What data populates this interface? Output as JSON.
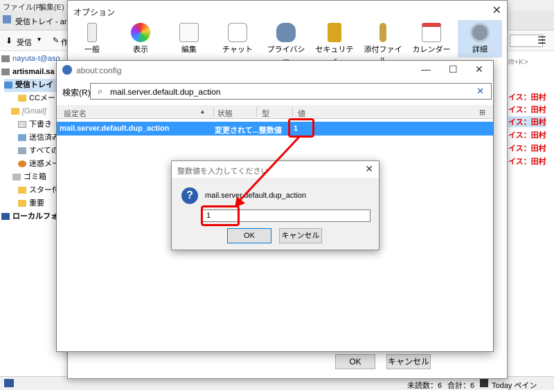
{
  "background": {
    "menu": [
      "ファイル(F)",
      "編集(E)"
    ],
    "tab_title": "受信トレイ - arti",
    "toolbar": {
      "receive": "受信",
      "write": "作"
    },
    "accounts": [
      "nayuta-t@aso",
      "artismail.sa"
    ],
    "folders": [
      "受信トレイ",
      "CCメール",
      "[Gmail]",
      "下書き",
      "送信済み",
      "すべてのメ",
      "迷惑メール",
      "ゴミ箱",
      "スター付き",
      "重要",
      "ローカルフォル"
    ],
    "right_search_hint": "ift+K>",
    "right_senders": [
      "イス：田村",
      "イス：田村",
      "イス：田村",
      "イス：田村",
      "イス：田村",
      "イス：田村"
    ],
    "status": {
      "unread": "未読数：6",
      "total": "合計：6",
      "today": "Today ペイン"
    }
  },
  "options": {
    "title": "オプション",
    "tabs": [
      "一般",
      "表示",
      "編集",
      "チャット",
      "プライバシー",
      "セキュリティ",
      "添付ファイル",
      "カレンダー",
      "詳細"
    ],
    "selected_tab": "詳細",
    "ok_label": "OK",
    "cancel_label": "キャンセル"
  },
  "about_config": {
    "title": "about:config",
    "search_label": "検索(R):",
    "search_value": "mail.server.default.dup_action",
    "columns": [
      "設定名",
      "状態",
      "型",
      "値"
    ],
    "row": {
      "name": "mail.server.default.dup_action",
      "status": "変更されて...",
      "type": "整数値",
      "value": "1"
    }
  },
  "prompt": {
    "title": "整数値を入力してください",
    "message": "mail.server.default.dup_action",
    "input_value": "1",
    "ok_label": "OK",
    "cancel_label": "キャンセル"
  },
  "colors": {
    "selection": "#3399ff",
    "highlight": "#e00000",
    "selected_tab": "#cde2f6"
  }
}
